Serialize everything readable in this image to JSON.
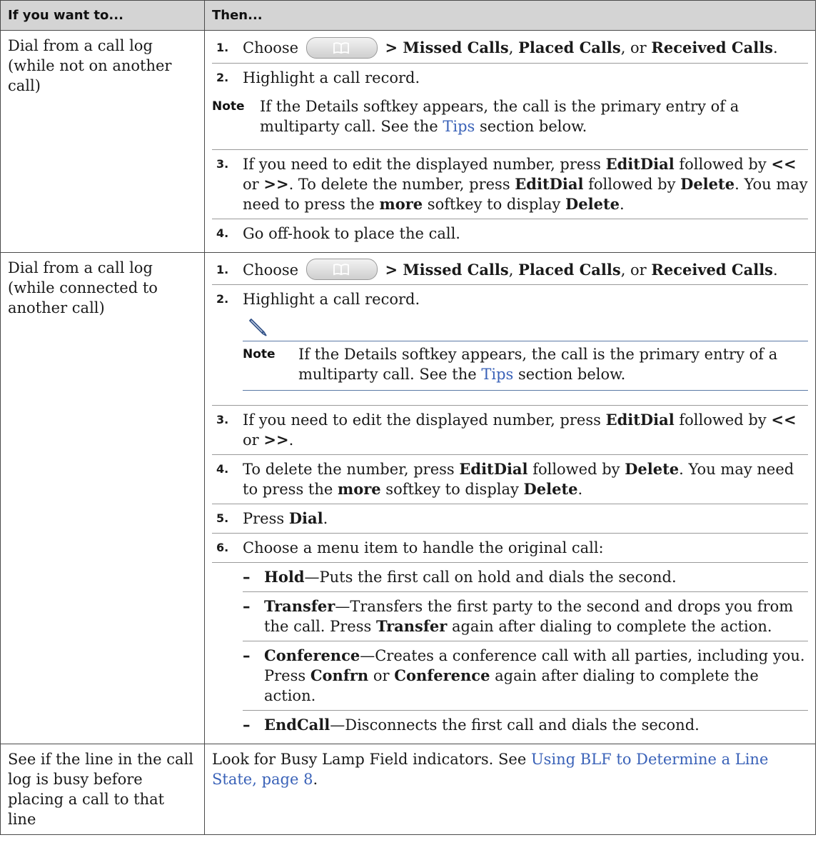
{
  "header": {
    "col1": "If you want to...",
    "col2": "Then..."
  },
  "row1": {
    "condition": "Dial from a call log (while not on another call)",
    "step1": {
      "num": "1.",
      "a": "Choose",
      "b": "> Missed Calls",
      "c": ", ",
      "d": "Placed Calls",
      "e": ", or ",
      "f": "Received Calls",
      "g": "."
    },
    "step2": {
      "num": "2.",
      "text": "Highlight a call record."
    },
    "note": {
      "label": "Note",
      "a": "If the Details softkey appears, the call is the primary entry of a multiparty call. See the ",
      "link": "Tips",
      "b": " section below."
    },
    "step3": {
      "num": "3.",
      "a": "If you need to edit the displayed number, press ",
      "b": "EditDial",
      "c": " followed by ",
      "d": "<<",
      "e": " or ",
      "f": ">>",
      "g": ". To delete the number, press ",
      "h": "EditDial",
      "i": " followed by ",
      "j": "Delete",
      "k": ". You may need to press the ",
      "l": "more",
      "m": " softkey to display ",
      "n": "Delete",
      "o": "."
    },
    "step4": {
      "num": "4.",
      "text": "Go off-hook to place the call."
    }
  },
  "row2": {
    "condition": "Dial from a call log (while connected to another call)",
    "step1": {
      "num": "1.",
      "a": "Choose",
      "b": "> Missed Calls",
      "c": ", ",
      "d": "Placed Calls",
      "e": ", or ",
      "f": "Received Calls",
      "g": "."
    },
    "step2": {
      "num": "2.",
      "text": "Highlight a call record."
    },
    "note": {
      "label": "Note",
      "a": "If the Details softkey appears, the call is the primary entry of a multiparty call. See the ",
      "link": "Tips",
      "b": " section below."
    },
    "step3": {
      "num": "3.",
      "a": "If you need to edit the displayed number, press ",
      "b": "EditDial",
      "c": " followed by ",
      "d": "<<",
      "e": " or ",
      "f": ">>",
      "g": "."
    },
    "step4": {
      "num": "4.",
      "a": "To delete the number, press ",
      "b": "EditDial",
      "c": " followed by ",
      "d": "Delete",
      "e": ". You may need to press the ",
      "f": "more",
      "g": " softkey to display ",
      "h": "Delete",
      "i": "."
    },
    "step5": {
      "num": "5.",
      "a": "Press ",
      "b": "Dial",
      "c": "."
    },
    "step6": {
      "num": "6.",
      "text": "Choose a menu item to handle the original call:"
    },
    "sub": [
      {
        "dash": "–",
        "term": "Hold",
        "rest": "—Puts the first call on hold and dials the second."
      },
      {
        "dash": "–",
        "term": "Transfer",
        "rest": "—Transfers the first party to the second and drops you from the call. Press ",
        "b": "Transfer",
        "c": " again after dialing to complete the action."
      },
      {
        "dash": "–",
        "term": "Conference",
        "rest": "—Creates a conference call with all parties, including you. Press ",
        "b": "Confrn",
        "c": " or ",
        "d": "Conference",
        "e": " again after dialing to complete the action."
      },
      {
        "dash": "–",
        "term": "EndCall",
        "rest": "—Disconnects the first call and dials the second."
      }
    ]
  },
  "row3": {
    "condition": "See if the line in the call log is busy before placing a call to that line",
    "a": "Look for Busy Lamp Field indicators. See ",
    "link": "Using BLF to Determine a Line State, page 8",
    "b": "."
  },
  "icons": {
    "directories": "book-icon",
    "note": "pencil-icon"
  }
}
